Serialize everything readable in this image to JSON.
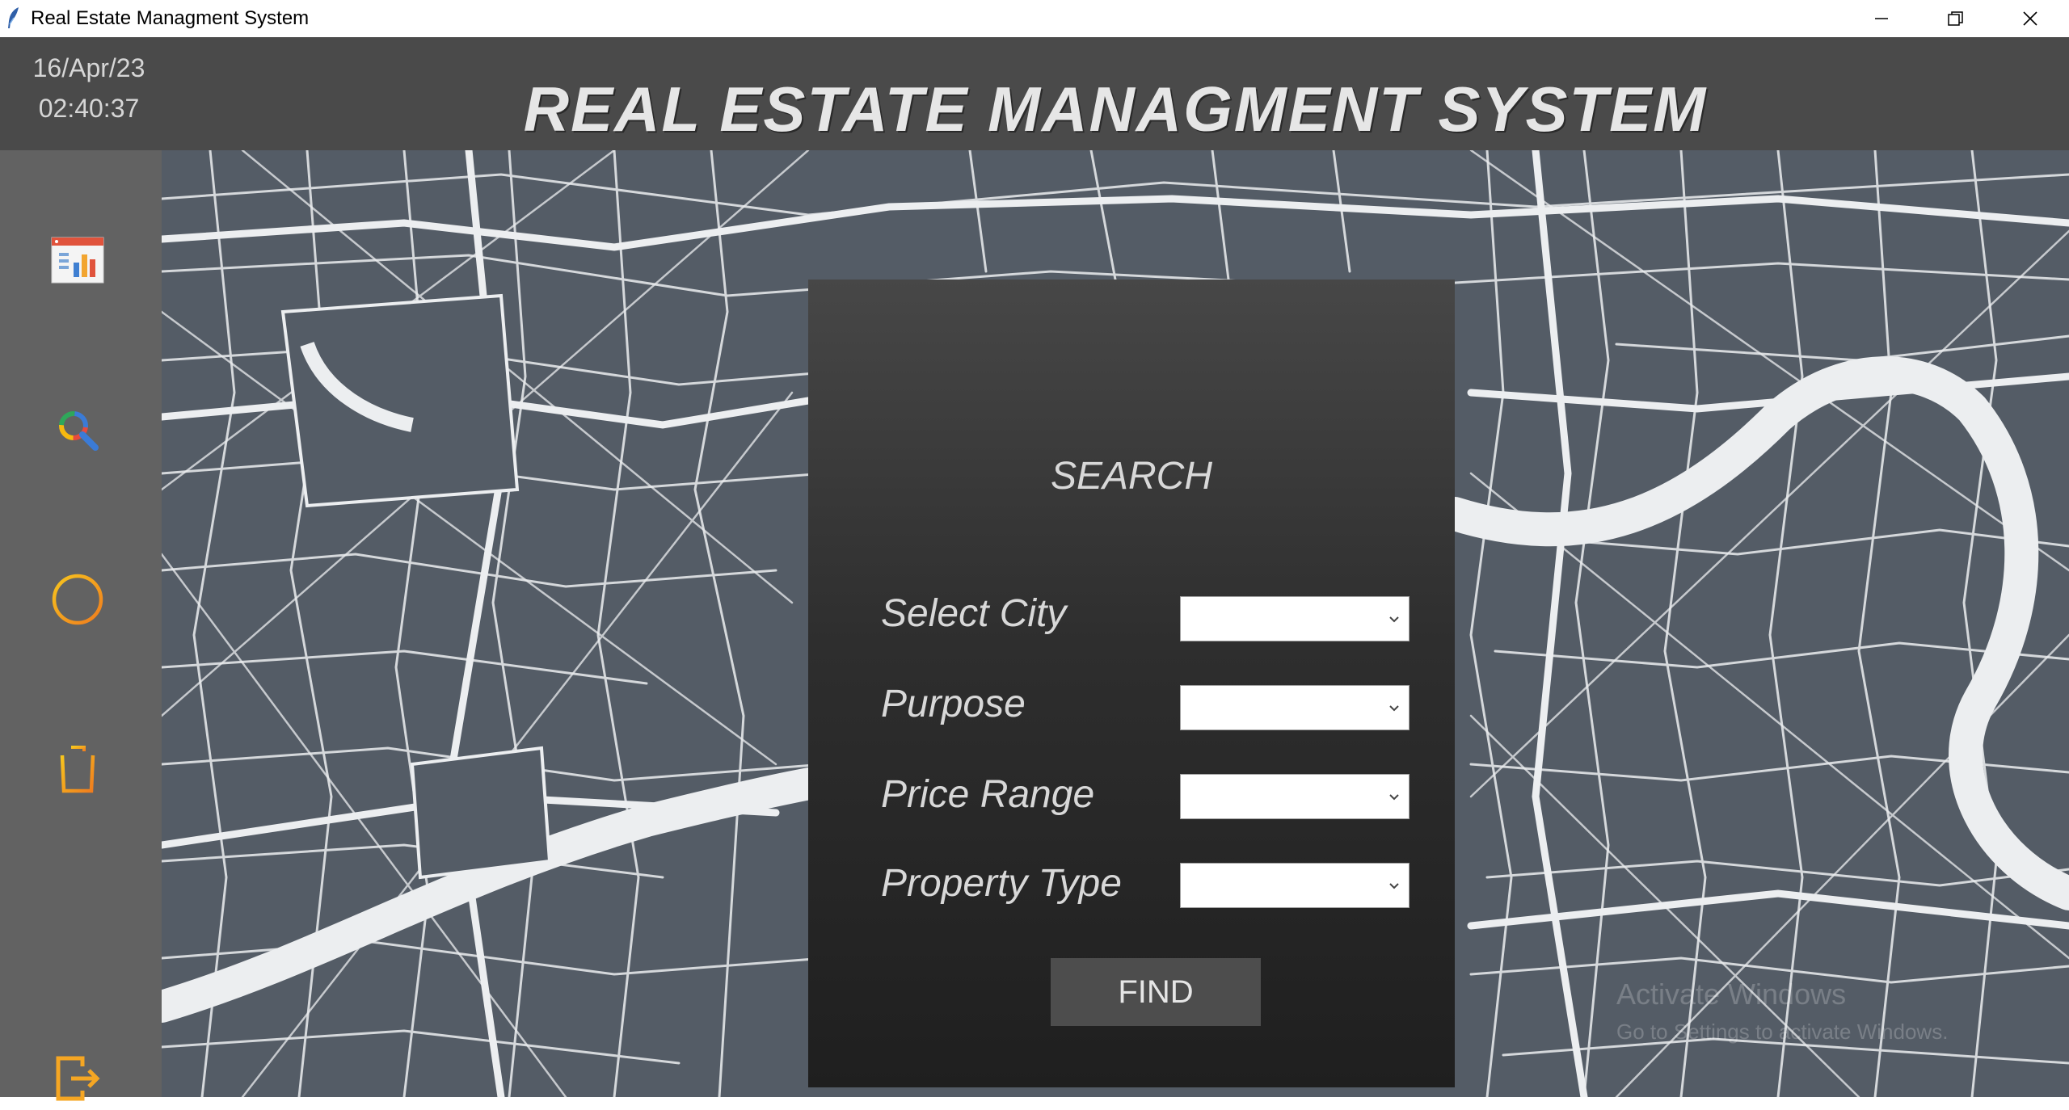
{
  "window": {
    "title": "Real Estate Managment System"
  },
  "header": {
    "date": "16/Apr/23",
    "time": "02:40:37",
    "app_title": "REAL ESTATE MANAGMENT SYSTEM"
  },
  "sidebar": {
    "items": [
      {
        "icon": "dashboard-chart-icon"
      },
      {
        "icon": "search-icon"
      },
      {
        "icon": "add-circle-icon"
      },
      {
        "icon": "trash-icon"
      },
      {
        "icon": "logout-icon"
      }
    ]
  },
  "search_panel": {
    "title": "SEARCH",
    "fields": [
      {
        "label": "Select City",
        "value": ""
      },
      {
        "label": "Purpose",
        "value": ""
      },
      {
        "label": "Price Range",
        "value": ""
      },
      {
        "label": "Property Type",
        "value": ""
      }
    ],
    "find_label": "FIND"
  },
  "watermark": {
    "line1": "Activate Windows",
    "line2": "Go to Settings to activate Windows."
  },
  "colors": {
    "header_bg": "#4a4a4a",
    "sidebar_bg": "#626262",
    "map_bg": "#545c66",
    "map_roads": "#eceef0",
    "panel_top": "#474747",
    "panel_bottom": "#1f1f1f",
    "button_bg": "#4d4d4d"
  }
}
